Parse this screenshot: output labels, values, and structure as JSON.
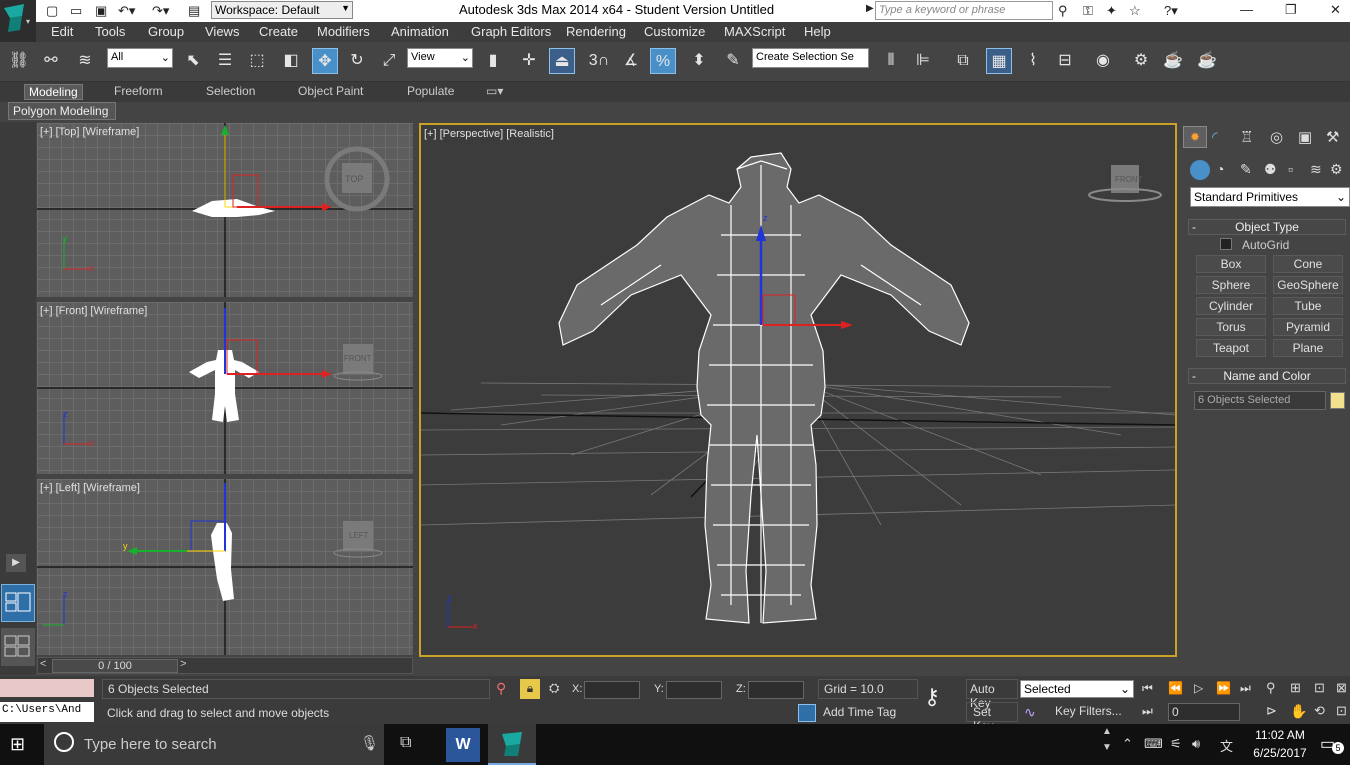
{
  "window": {
    "title": "Autodesk 3ds Max  2014 x64  - Student Version   Untitled",
    "workspace": "Workspace: Default",
    "search_placeholder": "Type a keyword or phrase"
  },
  "menu": [
    "Edit",
    "Tools",
    "Group",
    "Views",
    "Create",
    "Modifiers",
    "Animation",
    "Graph Editors",
    "Rendering",
    "Customize",
    "MAXScript",
    "Help"
  ],
  "toolbar": {
    "filter": "All",
    "ref_coord": "View",
    "snap_label": "3",
    "selection_set": "Create Selection Se"
  },
  "ribbon": {
    "tabs": [
      "Modeling",
      "Freeform",
      "Selection",
      "Object Paint",
      "Populate"
    ],
    "active": "Modeling",
    "panel": "Polygon Modeling"
  },
  "viewports": {
    "top": {
      "label": "[+] [Top] [Wireframe]",
      "cube": "TOP"
    },
    "front": {
      "label": "[+] [Front] [Wireframe]",
      "cube": "FRONT"
    },
    "left": {
      "label": "[+] [Left] [Wireframe]",
      "cube": "LEFT"
    },
    "perspective": {
      "label": "[+] [Perspective] [Realistic]",
      "cube": "FRONT"
    }
  },
  "axes": {
    "x": "x",
    "y": "y",
    "z": "z"
  },
  "timeslider": {
    "frame": "0 / 100",
    "current": 0,
    "total": 100
  },
  "status": {
    "selected": "6 Objects Selected",
    "prompt": "Click and drag to select and move objects",
    "x_label": "X:",
    "y_label": "Y:",
    "z_label": "Z:",
    "grid": "Grid = 10.0",
    "add_time_tag": "Add Time Tag",
    "auto_key": "Auto Key",
    "set_key": "Set Key",
    "key_mode": "Selected",
    "key_filters": "Key Filters...",
    "frame_value": "0",
    "maxscript_prompt": "C:\\Users\\And"
  },
  "command_panel": {
    "category": "Standard Primitives",
    "object_type_title": "Object Type",
    "autogrid": "AutoGrid",
    "buttons": [
      "Box",
      "Cone",
      "Sphere",
      "GeoSphere",
      "Cylinder",
      "Tube",
      "Torus",
      "Pyramid",
      "Teapot",
      "Plane"
    ],
    "name_color_title": "Name and Color",
    "name_value": "6 Objects Selected",
    "color": "#f2e08e"
  },
  "taskbar": {
    "search_placeholder": "Type here to search",
    "time": "11:02 AM",
    "date": "6/25/2017",
    "notifications": "5"
  },
  "colors": {
    "accent": "#4a90c8",
    "active_viewport": "#c9a227",
    "axis_x": "#d42020",
    "axis_y": "#1fb02f",
    "axis_z": "#2035d8"
  }
}
